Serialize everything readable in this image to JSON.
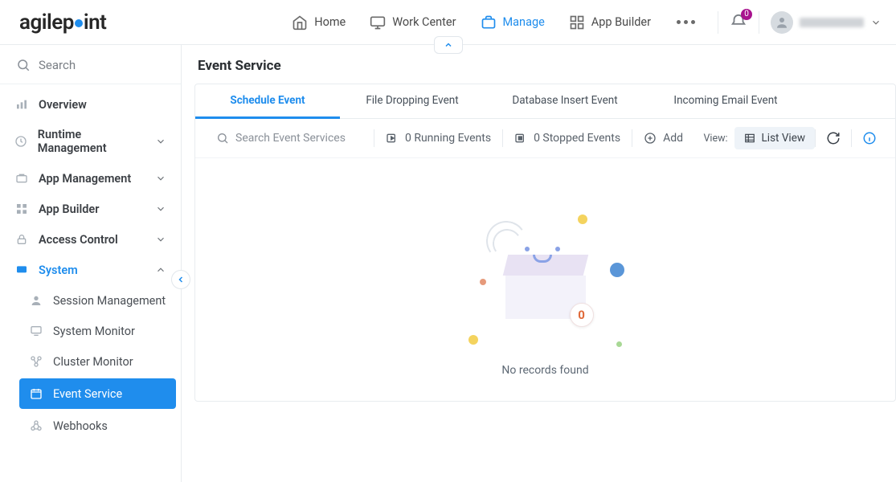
{
  "brand": {
    "part1": "agilep",
    "part2": "int"
  },
  "header": {
    "nav": [
      {
        "label": "Home",
        "icon": "home-icon",
        "active": false
      },
      {
        "label": "Work Center",
        "icon": "monitor-icon",
        "active": false
      },
      {
        "label": "Manage",
        "icon": "briefcase-icon",
        "active": true
      },
      {
        "label": "App Builder",
        "icon": "grid-icon",
        "active": false
      }
    ],
    "notification_count": "0"
  },
  "sidebar": {
    "search_placeholder": "Search",
    "items": [
      {
        "label": "Overview",
        "icon": "chart-icon",
        "type": "item"
      },
      {
        "label": "Runtime Management",
        "icon": "clock-icon",
        "type": "group",
        "expanded": false
      },
      {
        "label": "App Management",
        "icon": "briefcase2-icon",
        "type": "group",
        "expanded": false
      },
      {
        "label": "App Builder",
        "icon": "apps-icon",
        "type": "group",
        "expanded": false
      },
      {
        "label": "Access Control",
        "icon": "lock-icon",
        "type": "group",
        "expanded": false
      },
      {
        "label": "System",
        "icon": "system-icon",
        "type": "group",
        "expanded": true,
        "active": true,
        "children": [
          {
            "label": "Session Management",
            "icon": "user-icon"
          },
          {
            "label": "System Monitor",
            "icon": "monitor2-icon"
          },
          {
            "label": "Cluster Monitor",
            "icon": "cluster-icon"
          },
          {
            "label": "Event Service",
            "icon": "calendar-icon",
            "selected": true
          },
          {
            "label": "Webhooks",
            "icon": "webhook-icon"
          }
        ]
      }
    ]
  },
  "page": {
    "title": "Event Service",
    "tabs": [
      {
        "label": "Schedule Event",
        "active": true
      },
      {
        "label": "File Dropping Event",
        "active": false
      },
      {
        "label": "Database Insert Event",
        "active": false
      },
      {
        "label": "Incoming Email Event",
        "active": false
      }
    ],
    "toolbar": {
      "search_placeholder": "Search Event Services",
      "running": "0 Running Events",
      "stopped": "0 Stopped Events",
      "add": "Add",
      "view_label": "View:",
      "view_mode": "List View"
    },
    "empty": {
      "count": "0",
      "message": "No records found"
    }
  }
}
